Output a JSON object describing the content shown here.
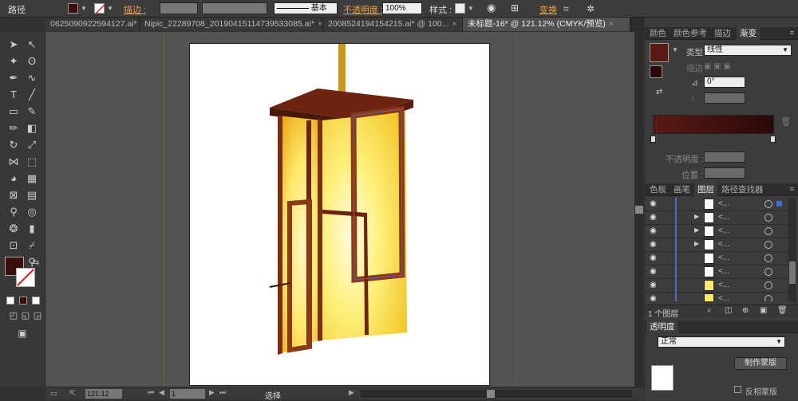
{
  "control_bar": {
    "object_type": "路径",
    "stroke_label": "描边 :",
    "stroke_profile": "基本",
    "opacity_label": "不透明度 :",
    "opacity_value": "100%",
    "style_label": "样式 :",
    "transform_label": "变换"
  },
  "tabs": [
    {
      "label": "0625090922594127.ai*"
    },
    {
      "label": "Nipic_22289708_20190415114739533085.ai*"
    },
    {
      "label": "2008524194154215.ai* @ 100..."
    },
    {
      "label": "未标题-16* @ 121.12% (CMYK/预览)"
    }
  ],
  "status_bar": {
    "zoom": "121.12",
    "page": "1",
    "tool_name": "选择"
  },
  "gradient_panel": {
    "tabs": [
      "颜色",
      "颜色参考",
      "描边",
      "渐变"
    ],
    "type_label": "类型 :",
    "type_value": "线性",
    "stroke_label": "描边",
    "angle_value": "0°",
    "opacity_label": "不透明度 :",
    "location_label": "位置 :",
    "colors": {
      "start": "#5a1a14",
      "end": "#2a0808"
    }
  },
  "layers_panel": {
    "tabs": [
      "色板",
      "画笔",
      "图层",
      "路径查找器"
    ],
    "layer_count": "1 个图层",
    "row_name": "<..."
  },
  "transparency_panel": {
    "title": "透明度",
    "mode": "正常",
    "make_mask_button": "制作蒙版",
    "invert_mask_label": "反相蒙版"
  },
  "colors": {
    "fill": "#3c0d0a",
    "frame": "#7a2e12",
    "lantern_light": "#fde96a",
    "lantern_dark": "#e8a511"
  }
}
